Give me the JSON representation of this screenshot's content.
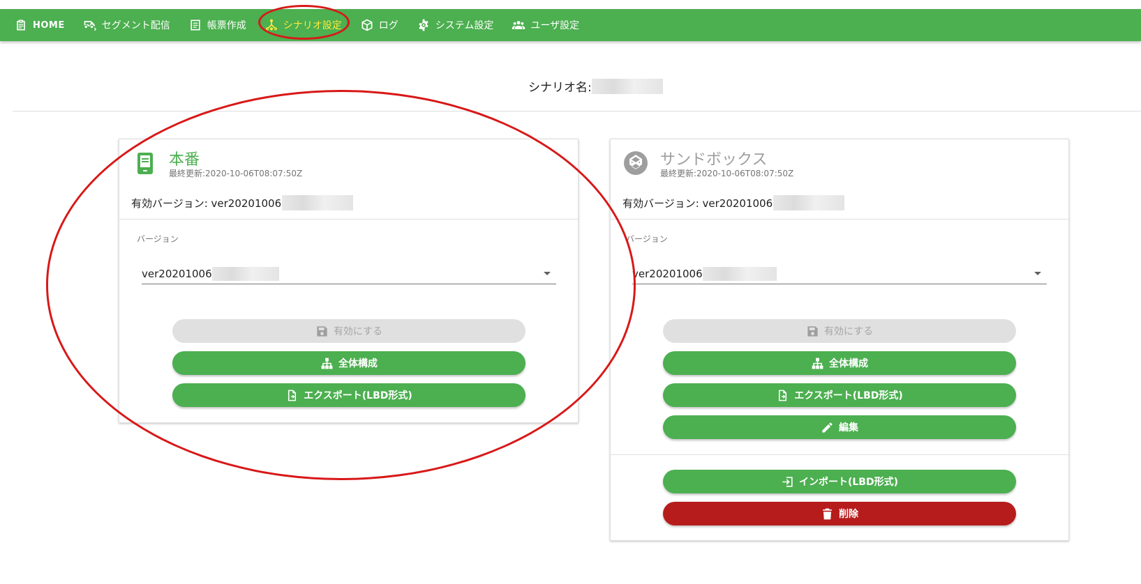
{
  "nav": {
    "items": [
      {
        "label": "HOME",
        "icon": "clipboard-icon"
      },
      {
        "label": "セグメント配信",
        "icon": "delivery-icon"
      },
      {
        "label": "帳票作成",
        "icon": "document-icon"
      },
      {
        "label": "シナリオ設定",
        "icon": "scenario-icon",
        "active": true
      },
      {
        "label": "ログ",
        "icon": "box-icon"
      },
      {
        "label": "システム設定",
        "icon": "gear-icon"
      },
      {
        "label": "ユーザ設定",
        "icon": "users-icon"
      }
    ]
  },
  "scenario": {
    "label": "シナリオ名: "
  },
  "production": {
    "title": "本番",
    "updated": "最終更新:2020-10-06T08:07:50Z",
    "active_version_label": "有効バージョン: ver20201006",
    "version_field_label": "バージョン",
    "version_value": "ver20201006",
    "buttons": {
      "activate": "有効にする",
      "overview": "全体構成",
      "export": "エクスポート(LBD形式)"
    }
  },
  "sandbox": {
    "title": "サンドボックス",
    "updated": "最終更新:2020-10-06T08:07:50Z",
    "active_version_label": "有効バージョン: ver20201006",
    "version_field_label": "バージョン",
    "version_value": "ver20201006",
    "buttons": {
      "activate": "有効にする",
      "overview": "全体構成",
      "export": "エクスポート(LBD形式)",
      "edit": "編集",
      "import": "インポート(LBD形式)",
      "delete": "削除"
    }
  },
  "colors": {
    "brand": "#4caf50",
    "active_nav": "#ffeb3b",
    "danger": "#b71c1c",
    "annotation": "#d81818"
  }
}
